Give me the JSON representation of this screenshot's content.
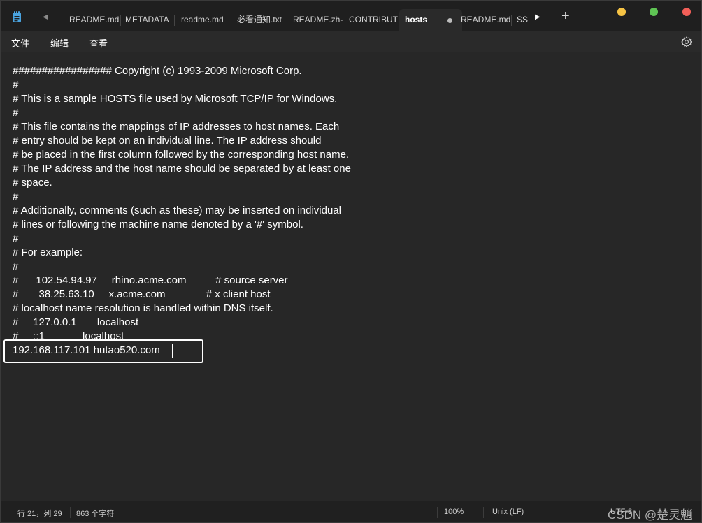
{
  "tabs": [
    {
      "label": "README.md"
    },
    {
      "label": "METADATA"
    },
    {
      "label": "readme.md"
    },
    {
      "label": "必看通知.txt"
    },
    {
      "label": "README.zh-"
    },
    {
      "label": "CONTRIBUTI"
    },
    {
      "label": "hosts"
    },
    {
      "label": "README.md"
    },
    {
      "label": "SS"
    }
  ],
  "menu": {
    "file": "文件",
    "edit": "编辑",
    "view": "查看"
  },
  "editor_lines": [
    "################# Copyright (c) 1993-2009 Microsoft Corp.",
    "#",
    "# This is a sample HOSTS file used by Microsoft TCP/IP for Windows.",
    "#",
    "# This file contains the mappings of IP addresses to host names. Each",
    "# entry should be kept on an individual line. The IP address should",
    "# be placed in the first column followed by the corresponding host name.",
    "# The IP address and the host name should be separated by at least one",
    "# space.",
    "#",
    "# Additionally, comments (such as these) may be inserted on individual",
    "# lines or following the machine name denoted by a '#' symbol.",
    "#",
    "# For example:",
    "#",
    "#      102.54.94.97     rhino.acme.com          # source server",
    "#       38.25.63.10     x.acme.com              # x client host",
    "# localhost name resolution is handled within DNS itself.",
    "#     127.0.0.1       localhost",
    "#     ::1             localhost",
    "192.168.117.101 hutao520.com"
  ],
  "status": {
    "position": "行 21，列 29",
    "char_count": "863 个字符",
    "zoom": "100%",
    "line_ending": "Unix (LF)",
    "encoding": "UTF-8"
  },
  "watermark": "CSDN @楚灵魈",
  "colors": {
    "background": "#272727",
    "tabbar": "#1f1f1f",
    "traffic_yellow": "#f6c344",
    "traffic_green": "#5fc454",
    "traffic_red": "#f25f58"
  },
  "icons": {
    "app": "notepad-icon",
    "settings": "gear-icon"
  }
}
